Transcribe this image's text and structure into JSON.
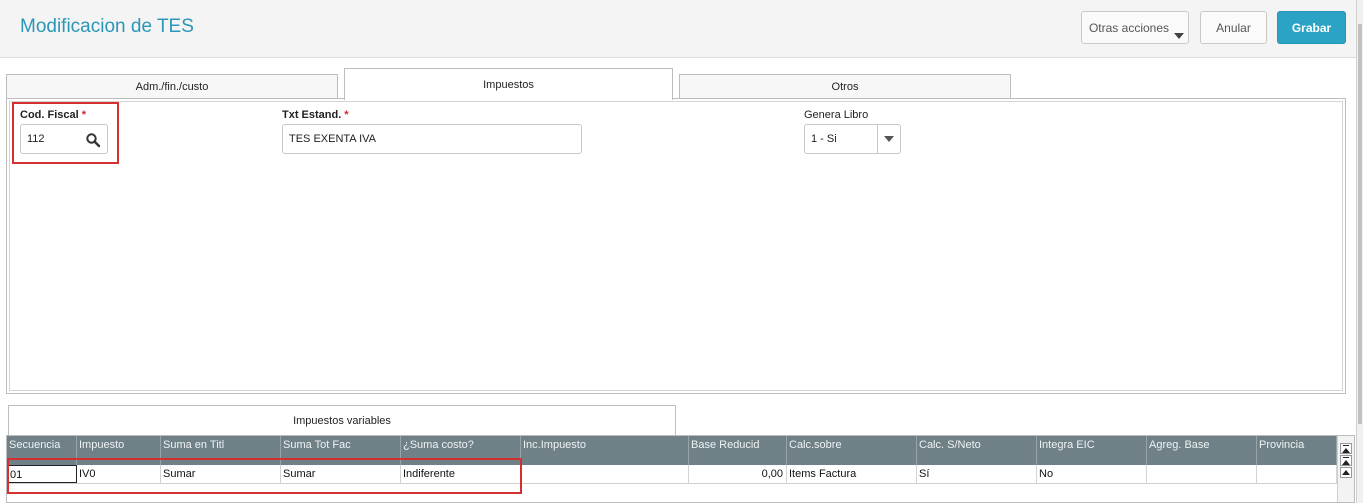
{
  "header": {
    "title": "Modificacion de TES",
    "buttons": {
      "otras": "Otras acciones",
      "anular": "Anular",
      "grabar": "Grabar"
    }
  },
  "tabs": [
    {
      "label": "Adm./fin./custo"
    },
    {
      "label": "Impuestos"
    },
    {
      "label": "Otros"
    }
  ],
  "form": {
    "cod_fiscal": {
      "label": "Cod. Fiscal",
      "required": "*",
      "value": "112"
    },
    "txt_estand": {
      "label": "Txt Estand.",
      "required": "*",
      "value": "TES EXENTA IVA"
    },
    "genera_libro": {
      "label": "Genera Libro",
      "value": "1 - Si"
    }
  },
  "subtab": {
    "label": "Impuestos variables"
  },
  "grid": {
    "columns": [
      "Secuencia",
      "Impuesto",
      "Suma en Titl",
      "Suma Tot Fac",
      "¿Suma costo?",
      "Inc.Impuesto",
      "Base Reducid",
      "Calc.sobre",
      "Calc. S/Neto",
      "Integra EIC",
      "Agreg. Base",
      "Provincia"
    ],
    "rows": [
      [
        "01",
        "IV0",
        "Sumar",
        "Sumar",
        "Indiferente",
        "",
        "0,00",
        "Items Factura",
        "Sí",
        "No",
        "",
        ""
      ]
    ]
  },
  "colors": {
    "accent": "#2aa3c5",
    "title": "#2b97b8",
    "highlight": "#d62f2f",
    "grid_header": "#6f8187"
  },
  "icons": {
    "search": "search-icon",
    "dropdown": "chevron-down-icon"
  }
}
